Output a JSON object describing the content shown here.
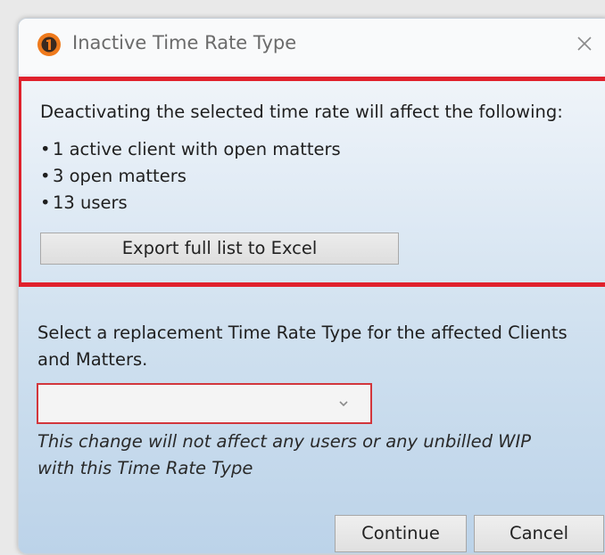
{
  "window": {
    "title": "Inactive Time Rate Type",
    "accent_color": "#e0212c"
  },
  "impact": {
    "heading": "Deactivating the selected time rate will affect the following:",
    "items": [
      "1 active client with open matters",
      "3 open matters",
      "13 users"
    ],
    "bullet": "•",
    "export_label": "Export full list to Excel"
  },
  "replacement": {
    "label": "Select a replacement Time Rate Type for the affected Clients and Matters.",
    "selected_value": "",
    "note": "This change will not affect any users or any unbilled WIP with this Time Rate Type"
  },
  "buttons": {
    "continue_label": "Continue",
    "cancel_label": "Cancel"
  },
  "icons": {
    "app": "app-logo-icon",
    "close": "close-icon",
    "dropdown": "chevron-down-icon"
  }
}
